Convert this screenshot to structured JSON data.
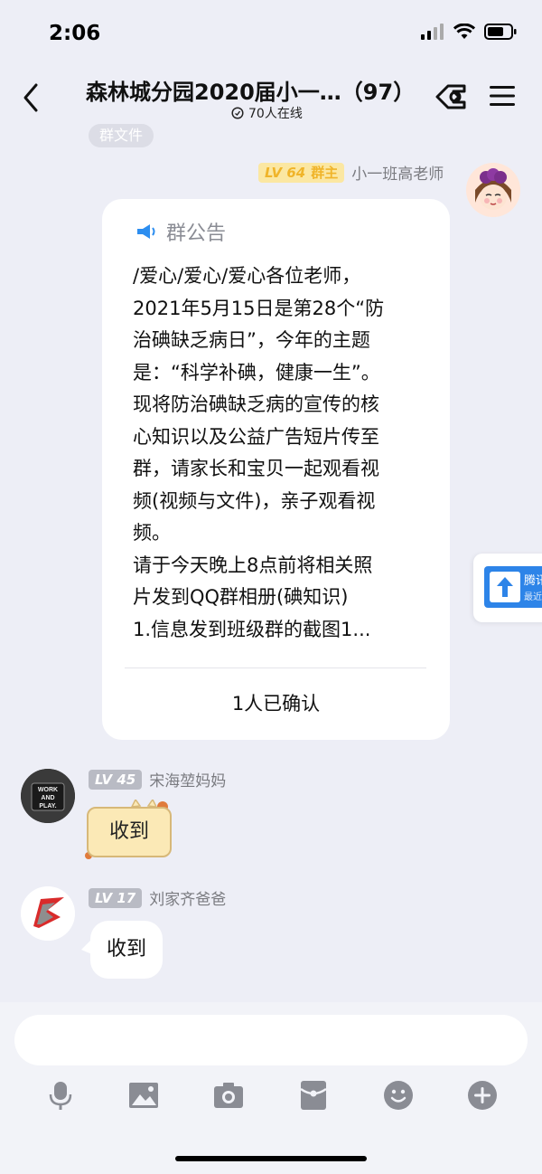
{
  "status": {
    "time": "2:06"
  },
  "header": {
    "title": "森林城分园2020届小一…（97）",
    "online": "70人在线"
  },
  "chips": {
    "file": "群文件"
  },
  "sender_teacher": {
    "level": "LV 64",
    "role": "群主",
    "name": "小一班高老师",
    "badge_color": "#f5c444"
  },
  "announcement": {
    "label": "群公告",
    "body": "/爱心/爱心/爱心各位老师，\n2021年5月15日是第28个“防\n治碘缺乏病日”，今年的主题\n是：“科学补碘，健康一生”。\n现将防治碘缺乏病的宣传的核\n心知识以及公益广告短片传至\n群，请家长和宝贝一起观看视\n频(视频与文件)，亲子观看视\n频。\n请于今天晚上8点前将相关照\n片发到QQ群相册(碘知识)\n1.信息发到班级群的截图1...",
    "confirm": "1人已确认"
  },
  "messages": [
    {
      "level": "LV 45",
      "name": "宋海堃妈妈",
      "text": "收到",
      "avatar_text": "WORK\nAND\nPLAY."
    },
    {
      "level": "LV 17",
      "name": "刘家齐爸爸",
      "text": "收到"
    }
  ],
  "side_widget": {
    "label_1": "腾讯",
    "label_2": "最近"
  },
  "icons": [
    "back-icon",
    "share-icon",
    "menu-icon",
    "mic-icon",
    "image-icon",
    "camera-icon",
    "red-packet-icon",
    "emoji-icon",
    "plus-icon"
  ],
  "colors": {
    "accent_blue": "#2d84e8",
    "owner_badge": "#f5c444",
    "level_badge": "#b9bbc4"
  }
}
